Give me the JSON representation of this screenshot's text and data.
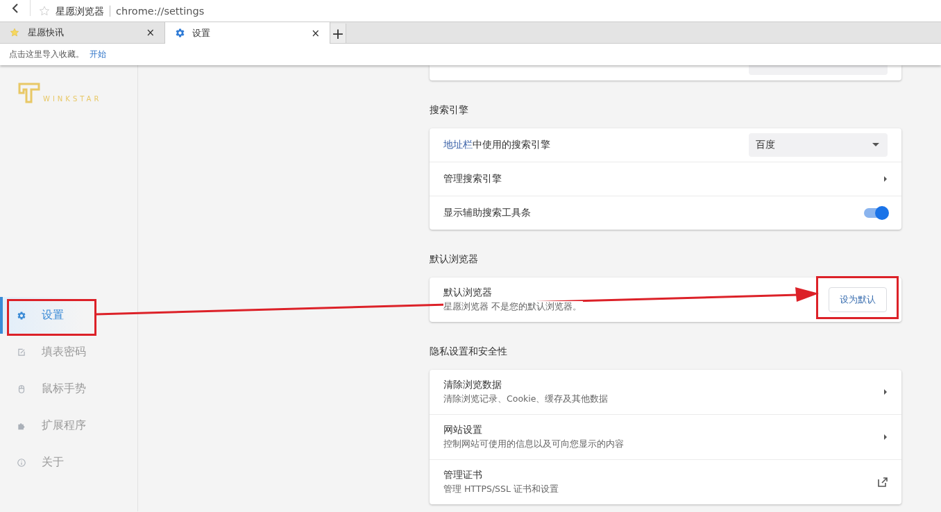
{
  "address_bar": {
    "site_name": "星愿浏览器",
    "url": "chrome://settings"
  },
  "tabs": [
    {
      "title": "星愿快讯",
      "close": "×",
      "selected": false
    },
    {
      "title": "设置",
      "close": "×",
      "selected": true
    }
  ],
  "new_tab": "+",
  "bookmark_bar": {
    "message": "点击这里导入收藏。",
    "link": "开始"
  },
  "sidebar": {
    "logo_text": "WINKSTAR",
    "items": [
      {
        "label": "设置",
        "selected": true
      },
      {
        "label": "填表密码",
        "selected": false
      },
      {
        "label": "鼠标手势",
        "selected": false
      },
      {
        "label": "扩展程序",
        "selected": false
      },
      {
        "label": "关于",
        "selected": false
      }
    ]
  },
  "sections": [
    {
      "title": "搜索引擎",
      "rows": [
        {
          "kind": "dropdown",
          "link": "地址栏",
          "label": "中使用的搜索引擎",
          "value": "百度"
        },
        {
          "kind": "arrow",
          "label": "管理搜索引擎"
        },
        {
          "kind": "toggle",
          "label": "显示辅助搜索工具条",
          "on": true
        }
      ]
    },
    {
      "title": "默认浏览器",
      "rows": [
        {
          "kind": "button",
          "label": "默认浏览器",
          "sublabel": "星愿浏览器 不是您的默认浏览器。",
          "button": "设为默认"
        }
      ]
    },
    {
      "title": "隐私设置和安全性",
      "rows": [
        {
          "kind": "arrow",
          "label": "清除浏览数据",
          "sublabel": "清除浏览记录、Cookie、缓存及其他数据"
        },
        {
          "kind": "arrow",
          "label": "网站设置",
          "sublabel": "控制网站可使用的信息以及可向您显示的内容"
        },
        {
          "kind": "external",
          "label": "管理证书",
          "sublabel": "管理 HTTPS/SSL 证书和设置"
        }
      ]
    }
  ],
  "annotations": [
    {
      "kind": "box"
    },
    {
      "kind": "box"
    },
    {
      "kind": "arrow"
    }
  ]
}
